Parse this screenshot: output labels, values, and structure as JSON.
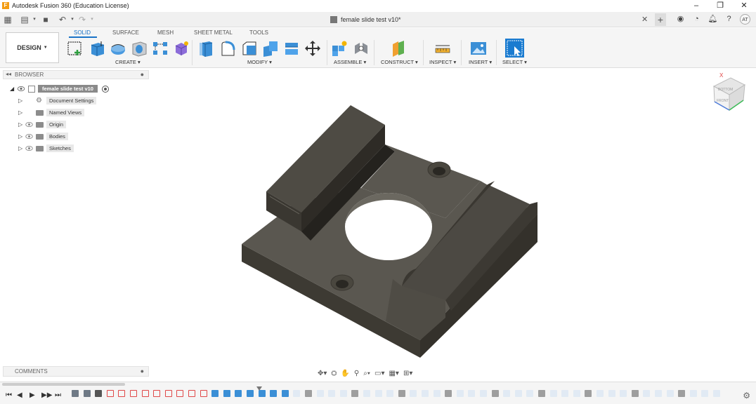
{
  "window": {
    "title": "Autodesk Fusion 360 (Education License)",
    "logo_letter": "F"
  },
  "document": {
    "name": "female slide test v10*"
  },
  "user": {
    "initials": "AT"
  },
  "workspace": {
    "label": "DESIGN"
  },
  "tabs": [
    {
      "label": "SOLID",
      "active": true
    },
    {
      "label": "SURFACE"
    },
    {
      "label": "MESH"
    },
    {
      "label": "SHEET METAL"
    },
    {
      "label": "TOOLS"
    }
  ],
  "groups": [
    {
      "label": "CREATE ▾"
    },
    {
      "label": "MODIFY ▾"
    },
    {
      "label": "ASSEMBLE ▾"
    },
    {
      "label": "CONSTRUCT ▾"
    },
    {
      "label": "INSPECT ▾"
    },
    {
      "label": "INSERT ▾"
    },
    {
      "label": "SELECT ▾"
    }
  ],
  "browser": {
    "title": "BROWSER",
    "root": "female slide test v10",
    "nodes": [
      {
        "label": "Document Settings",
        "icon": "gear-icon"
      },
      {
        "label": "Named Views",
        "icon": "folder-icon"
      },
      {
        "label": "Origin",
        "icon": "folder-icon"
      },
      {
        "label": "Bodies",
        "icon": "folder-icon"
      },
      {
        "label": "Sketches",
        "icon": "folder-icon"
      }
    ]
  },
  "comments": {
    "title": "COMMENTS"
  },
  "viewcube": {
    "axis_x": "X",
    "face_front": "BOTTOM",
    "face_side": "FRONT"
  },
  "colors": {
    "accent": "#1a73c7",
    "body_top": "#5a5750",
    "body_side": "#454239"
  }
}
